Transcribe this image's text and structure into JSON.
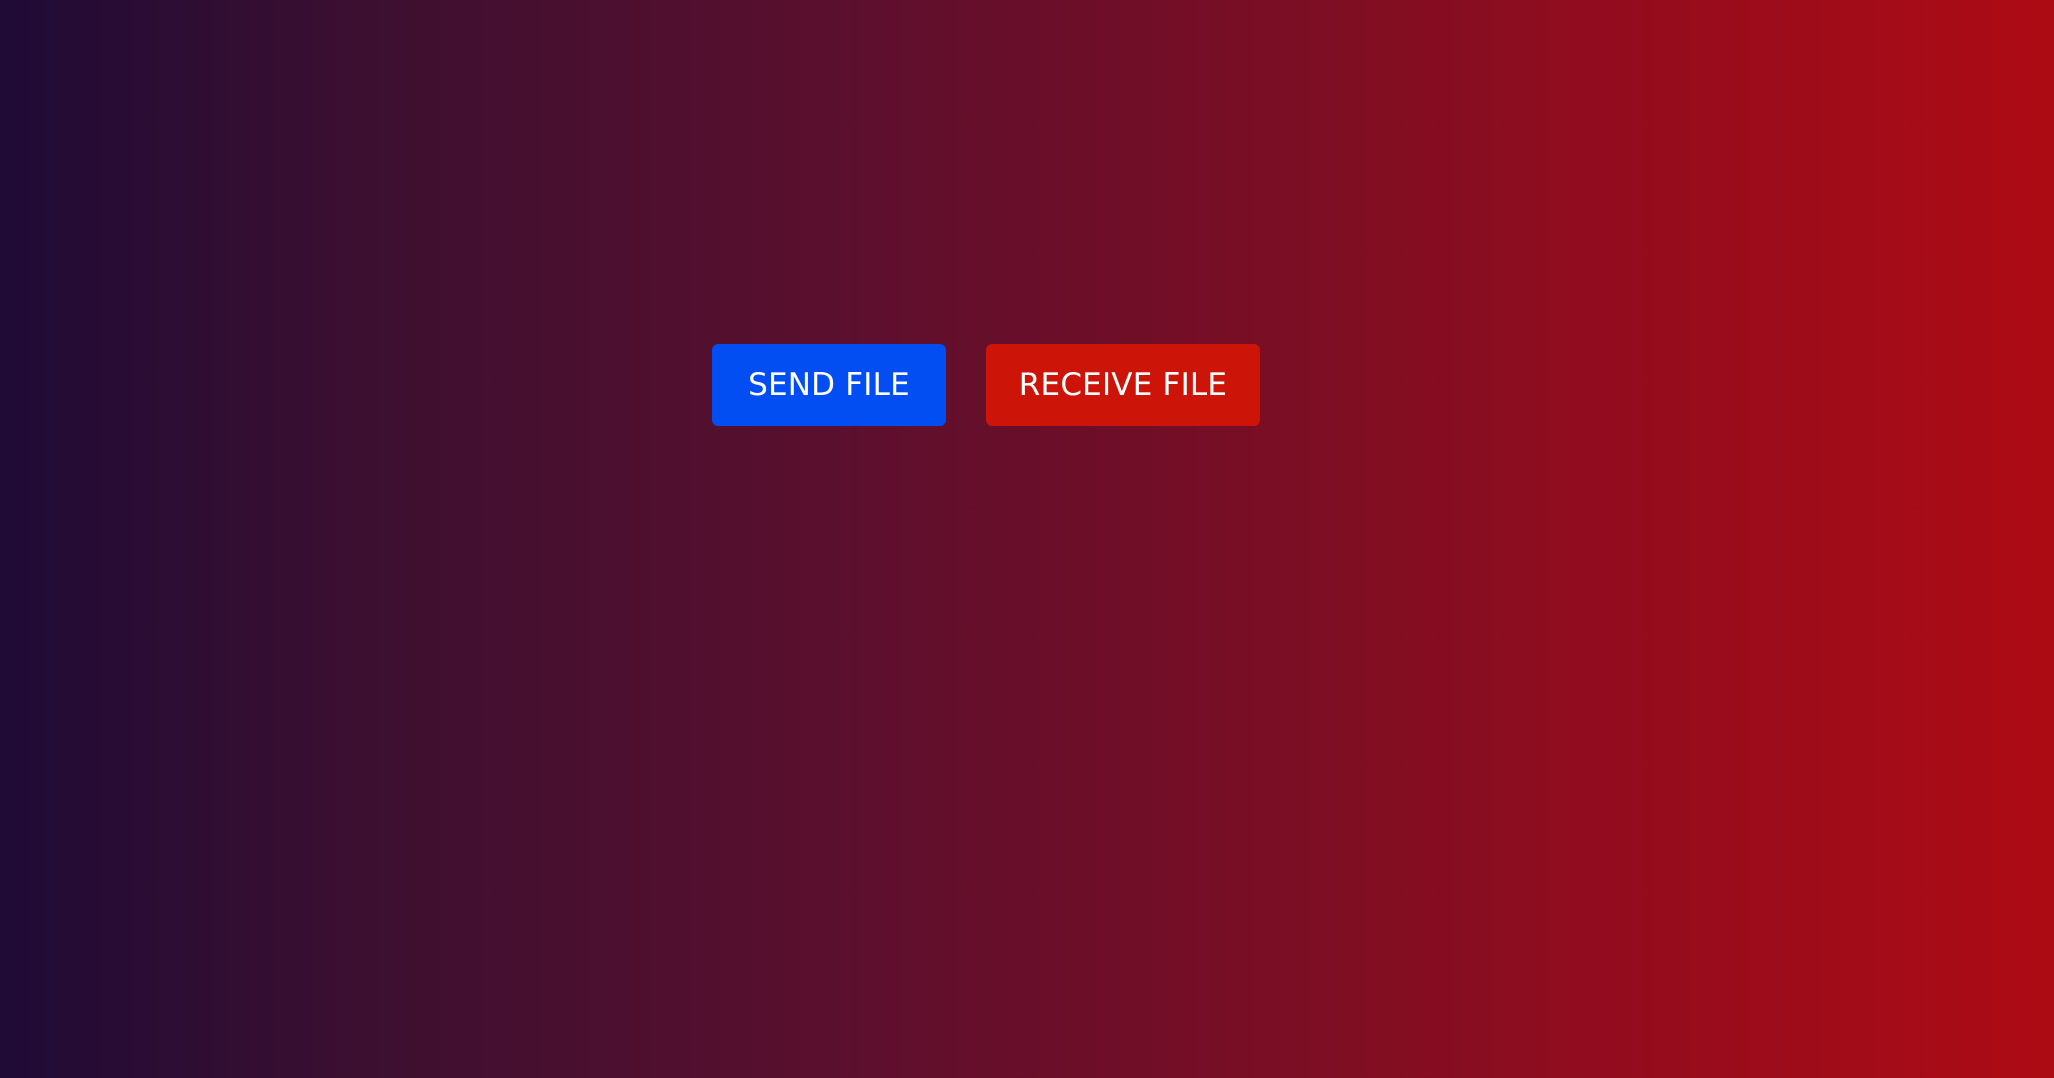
{
  "actions": {
    "send_label": "SEND FILE",
    "receive_label": "RECEIVE FILE"
  },
  "colors": {
    "send_button": "#034ef3",
    "receive_button": "#cc1408",
    "background_left": "#1f0b36",
    "background_right": "#ad0b14",
    "button_text": "#ffffff"
  }
}
